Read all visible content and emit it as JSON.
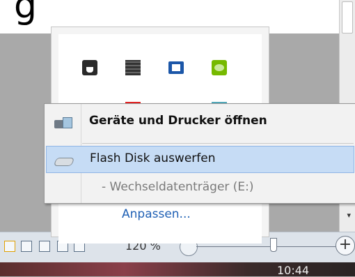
{
  "document": {
    "heading_fragment": "g"
  },
  "tray": {
    "icons": [
      "java-icon",
      "film-icon",
      "dolby-icon",
      "nvidia-icon",
      "red-app-icon",
      "teal-app-icon"
    ],
    "customize_link": "Anpassen..."
  },
  "context_menu": {
    "items": [
      {
        "label": "Geräte und Drucker öffnen",
        "icon": "devices-printers-icon",
        "bold": true
      },
      {
        "label": "Flash Disk auswerfen",
        "icon": "usb-drive-icon",
        "highlighted": true
      },
      {
        "label": "- Wechseldatenträger (E:)",
        "disabled": true
      }
    ]
  },
  "statusbar": {
    "zoom_label": "120 %",
    "zoom_in": "+"
  },
  "taskbar": {
    "clock": "10:44"
  },
  "colors": {
    "highlight": "#c6dcf5",
    "link": "#1e5fb4"
  }
}
